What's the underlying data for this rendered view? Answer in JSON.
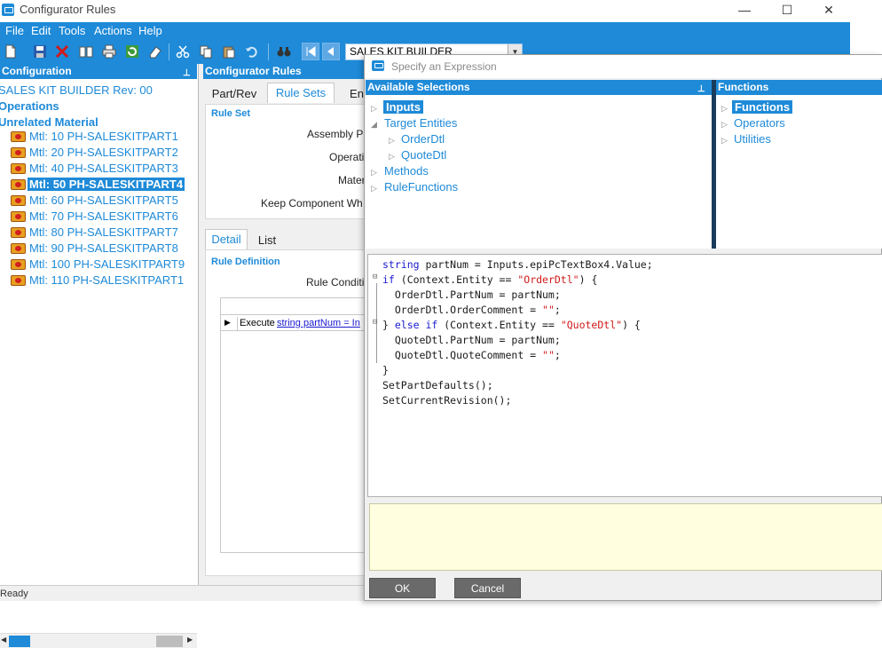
{
  "window": {
    "title": "Configurator Rules",
    "minimize": "—",
    "maximize": "☐",
    "close": "✕"
  },
  "menu": [
    "File",
    "Edit",
    "Tools",
    "Actions",
    "Help"
  ],
  "toolbar": {
    "kit_selector_value": "SALES KIT BUILDER"
  },
  "tree": {
    "header": "Configuration",
    "root": "SALES KIT BUILDER Rev: 00",
    "operations": "Operations",
    "unrelated": "Unrelated Material",
    "items": [
      "Mtl: 10 PH-SALESKITPART1",
      "Mtl: 20 PH-SALESKITPART2",
      "Mtl: 40 PH-SALESKITPART3",
      "Mtl: 50 PH-SALESKITPART4",
      "Mtl: 60 PH-SALESKITPART5",
      "Mtl: 70 PH-SALESKITPART6",
      "Mtl: 80 PH-SALESKITPART7",
      "Mtl: 90 PH-SALESKITPART8",
      "Mtl: 100 PH-SALESKITPART9",
      "Mtl: 110 PH-SALESKITPART1"
    ],
    "selected_index": 3
  },
  "rules": {
    "header": "Configurator Rules",
    "tabs": [
      "Part/Rev",
      "Rule Sets",
      "En"
    ],
    "active_tab": "Rule Sets",
    "rule_set_title": "Rule Set",
    "fields": [
      "Assembly P",
      "Operati",
      "Mater",
      "Keep Component Wh"
    ],
    "subtabs": [
      "Detail",
      "List"
    ],
    "rule_definition_title": "Rule Definition",
    "rule_condition_label": "Rule Conditi",
    "grid_row_label": "Execute",
    "grid_row_link": "string partNum = In"
  },
  "dialog": {
    "title": "Specify an Expression",
    "available_header": "Available Selections",
    "functions_header": "Functions",
    "available": {
      "inputs": "Inputs",
      "target_entities": "Target Entities",
      "order_dtl": "OrderDtl",
      "quote_dtl": "QuoteDtl",
      "methods": "Methods",
      "rule_functions": "RuleFunctions"
    },
    "functions": {
      "functions": "Functions",
      "operators": "Operators",
      "utilities": "Utilities"
    },
    "code": {
      "l1_kw": "string",
      "l1_rest": " partNum = Inputs.epiPcTextBox4.Value;",
      "l2_kw": "if",
      "l2_a": " (Context.Entity == ",
      "l2_str": "\"OrderDtl\"",
      "l2_b": ") {",
      "l3": "  OrderDtl.PartNum = partNum;",
      "l4_a": "  OrderDtl.OrderComment = ",
      "l4_str": "\"\"",
      "l4_b": ";",
      "l5_a": "} ",
      "l5_kw": "else if",
      "l5_b": " (Context.Entity == ",
      "l5_str": "\"QuoteDtl\"",
      "l5_c": ") {",
      "l6": "  QuoteDtl.PartNum = partNum;",
      "l7_a": "  QuoteDtl.QuoteComment = ",
      "l7_str": "\"\"",
      "l7_b": ";",
      "l8": "}",
      "l9": "SetPartDefaults();",
      "l10": "SetCurrentRevision();"
    },
    "ok_label": "OK",
    "cancel_label": "Cancel"
  },
  "status": {
    "text": "Ready"
  },
  "colors": {
    "accent": "#1e8ad8",
    "keyword": "#1a1ad0",
    "string": "#d01a1a",
    "message_bg": "#ffffe0"
  }
}
